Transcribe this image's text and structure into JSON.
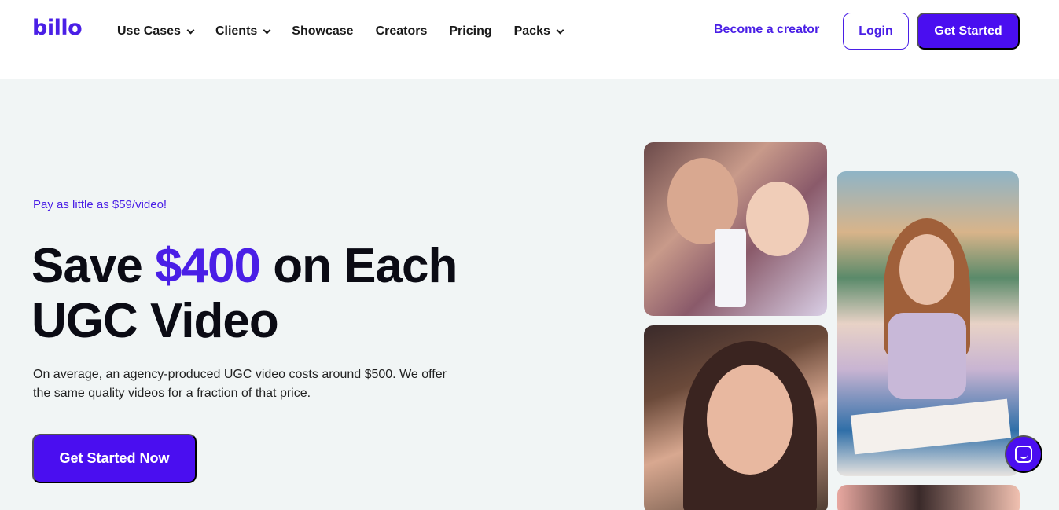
{
  "brand": {
    "logo_text": "billo",
    "accent": "#4a1fe6",
    "button_color": "#4a0ef0"
  },
  "nav": {
    "items": [
      {
        "label": "Use Cases",
        "has_dropdown": true
      },
      {
        "label": "Clients",
        "has_dropdown": true
      },
      {
        "label": "Showcase",
        "has_dropdown": false
      },
      {
        "label": "Creators",
        "has_dropdown": false
      },
      {
        "label": "Pricing",
        "has_dropdown": false
      },
      {
        "label": "Packs",
        "has_dropdown": true
      }
    ],
    "creator_link": "Become a creator",
    "login_label": "Login",
    "get_started_label": "Get Started"
  },
  "hero": {
    "eyebrow": "Pay as little as $59/video!",
    "headline_part1": "Save ",
    "headline_accent": "$400",
    "headline_part2": " on Each UGC Video",
    "description": "On average, an agency-produced UGC video costs around $500. We offer the same quality videos for a fraction of that price.",
    "cta_label": "Get Started Now"
  },
  "photos": [
    {
      "name": "photo-mother-baby-product"
    },
    {
      "name": "photo-woman-selfie"
    },
    {
      "name": "photo-woman-reading-book"
    },
    {
      "name": "photo-partial-bottom"
    }
  ],
  "chat": {
    "icon": "chat-icon"
  }
}
